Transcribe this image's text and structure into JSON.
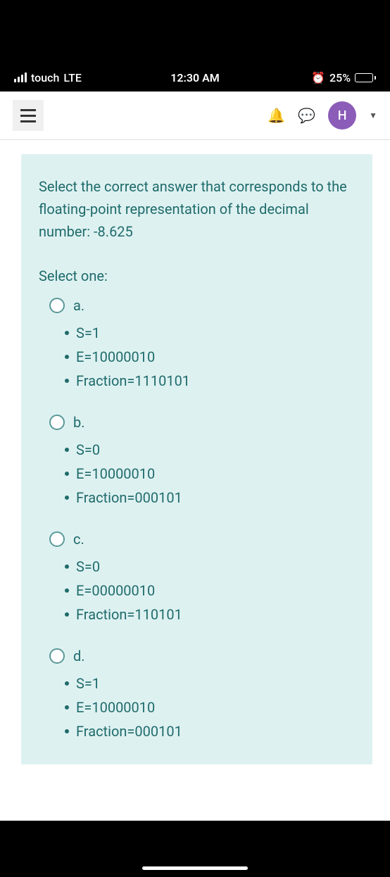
{
  "statusBar": {
    "carrier": "touch",
    "network": "LTE",
    "time": "12:30 AM",
    "batteryPercent": "25%"
  },
  "header": {
    "avatarLetter": "H"
  },
  "question": {
    "prompt": "Select the correct answer that corresponds to the floating-point representation of the decimal number: -8.625",
    "selectOne": "Select one:",
    "options": {
      "a": {
        "label": "a.",
        "s": "S=1",
        "e": "E=10000010",
        "f": "Fraction=1110101"
      },
      "b": {
        "label": "b.",
        "s": "S=0",
        "e": "E=10000010",
        "f": "Fraction=000101"
      },
      "c": {
        "label": "c.",
        "s": "S=0",
        "e": "E=00000010",
        "f": "Fraction=110101"
      },
      "d": {
        "label": "d.",
        "s": "S=1",
        "e": "E=10000010",
        "f": "Fraction=000101"
      }
    }
  }
}
